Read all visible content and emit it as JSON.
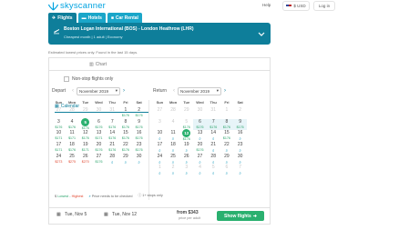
{
  "header": {
    "logo_text": "skyscanner",
    "help_label": "Help",
    "currency_label": "$ USD",
    "login_label": "Log in",
    "tabs": [
      {
        "label": "Flights",
        "icon": "plane-icon",
        "active": true
      },
      {
        "label": "Hotels",
        "icon": "bed-icon",
        "active": false
      },
      {
        "label": "Car Rental",
        "icon": "car-icon",
        "active": false
      }
    ]
  },
  "search": {
    "route": "Boston Logan International (BOS) - London Heathrow (LHR)",
    "details": "Cheapest month  |  1 adult  |  Economy"
  },
  "estimate_note": "Estimated lowest prices only. Found in the last 15 days.",
  "view_tabs": {
    "calendar_label": "Calendar",
    "chart_label": "Chart"
  },
  "nonstop_label": "Non-stop flights only",
  "depart": {
    "label": "Depart",
    "month": "November 2019"
  },
  "return": {
    "label": "Return",
    "month": "November 2019"
  },
  "weekdays": [
    "Sun",
    "Mon",
    "Tue",
    "Wed",
    "Thu",
    "Fri",
    "Sat"
  ],
  "depart_days": [
    {
      "d": "27",
      "m": true
    },
    {
      "d": "28",
      "m": true
    },
    {
      "d": "29",
      "m": true
    },
    {
      "d": "30",
      "m": true
    },
    {
      "d": "31",
      "m": true
    },
    {
      "d": "1",
      "p": "$176"
    },
    {
      "d": "2",
      "p": "$176"
    },
    {
      "d": "3",
      "p": "$176"
    },
    {
      "d": "4",
      "p": "$176"
    },
    {
      "d": "5",
      "p": "$176",
      "sel": true
    },
    {
      "d": "6",
      "p": "$176"
    },
    {
      "d": "7",
      "p": "$176"
    },
    {
      "d": "8",
      "p": "$176"
    },
    {
      "d": "9",
      "p": "$176"
    },
    {
      "d": "10",
      "p": "$171"
    },
    {
      "d": "11",
      "p": "$171"
    },
    {
      "d": "12",
      "p": "$176"
    },
    {
      "d": "13",
      "p": "$171"
    },
    {
      "d": "14",
      "p": "$176"
    },
    {
      "d": "15",
      "p": "$176"
    },
    {
      "d": "16",
      "p": "$176"
    },
    {
      "d": "17",
      "p": "$171"
    },
    {
      "d": "18",
      "p": "$176"
    },
    {
      "d": "19",
      "p": "$171"
    },
    {
      "d": "20",
      "p": "$176"
    },
    {
      "d": "21",
      "p": "$176"
    },
    {
      "d": "22",
      "p": "$176"
    },
    {
      "d": "23",
      "p": "$176"
    },
    {
      "d": "24",
      "p": "$273",
      "hi": true
    },
    {
      "d": "25",
      "p": "$275",
      "hi": true
    },
    {
      "d": "26",
      "p": "$270",
      "hi": true
    },
    {
      "d": "27",
      "p": "$176"
    },
    {
      "d": "28",
      "q": true
    },
    {
      "d": "29",
      "q": true
    },
    {
      "d": "30",
      "q": true
    },
    {
      "d": "",
      "blank": true
    },
    {
      "d": "",
      "blank": true
    },
    {
      "d": "",
      "blank": true
    },
    {
      "d": "",
      "blank": true
    },
    {
      "d": "",
      "blank": true
    },
    {
      "d": "",
      "blank": true
    },
    {
      "d": "",
      "blank": true
    }
  ],
  "return_days": [
    {
      "d": "27",
      "m": true
    },
    {
      "d": "28",
      "m": true
    },
    {
      "d": "29",
      "m": true
    },
    {
      "d": "30",
      "m": true
    },
    {
      "d": "31",
      "m": true
    },
    {
      "d": "1",
      "m": true
    },
    {
      "d": "2",
      "m": true
    },
    {
      "d": "3",
      "m": true
    },
    {
      "d": "4",
      "m": true
    },
    {
      "d": "5",
      "m": true,
      "p": "$176"
    },
    {
      "d": "6",
      "p": "$176",
      "r": true
    },
    {
      "d": "7",
      "p": "$176",
      "r": true
    },
    {
      "d": "8",
      "p": "$176",
      "r": true
    },
    {
      "d": "9",
      "p": "$176",
      "r": true
    },
    {
      "d": "10",
      "q": true
    },
    {
      "d": "11",
      "q": true
    },
    {
      "d": "12",
      "p": "$176",
      "sel": true
    },
    {
      "d": "13",
      "q": true
    },
    {
      "d": "14",
      "q": true
    },
    {
      "d": "15",
      "p": "$176"
    },
    {
      "d": "16",
      "q": true
    },
    {
      "d": "17",
      "q": true
    },
    {
      "d": "18",
      "q": true
    },
    {
      "d": "19",
      "q": true
    },
    {
      "d": "20",
      "p": "$176"
    },
    {
      "d": "21",
      "q": true
    },
    {
      "d": "22",
      "q": true
    },
    {
      "d": "23",
      "q": true
    },
    {
      "d": "24",
      "q": true
    },
    {
      "d": "25",
      "q": true
    },
    {
      "d": "26",
      "q": true
    },
    {
      "d": "27",
      "q": true
    },
    {
      "d": "28",
      "q": true
    },
    {
      "d": "29",
      "q": true
    },
    {
      "d": "30",
      "q": true
    },
    {
      "d": "1",
      "m": true,
      "q": true
    },
    {
      "d": "2",
      "m": true,
      "q": true
    },
    {
      "d": "3",
      "m": true,
      "q": true
    },
    {
      "d": "4",
      "m": true,
      "q": true
    },
    {
      "d": "5",
      "m": true,
      "q": true
    },
    {
      "d": "6",
      "m": true,
      "q": true
    },
    {
      "d": "7",
      "m": true,
      "q": true
    }
  ],
  "legend": {
    "low_label": "Lowest",
    "high_label": "Highest",
    "check_label": "Price needs to be checked",
    "stops_label": "1+ stops only"
  },
  "summary": {
    "outbound": "Tue, Nov 5",
    "inbound": "Tue, Nov 12",
    "from_price": "from $343",
    "per_adult": "price per adult",
    "button_label": "Show flights"
  },
  "colors": {
    "brand": "#0e7e9a",
    "low_price": "#2aa36b",
    "high_price": "#e0462f",
    "selected": "#2ab06f"
  }
}
